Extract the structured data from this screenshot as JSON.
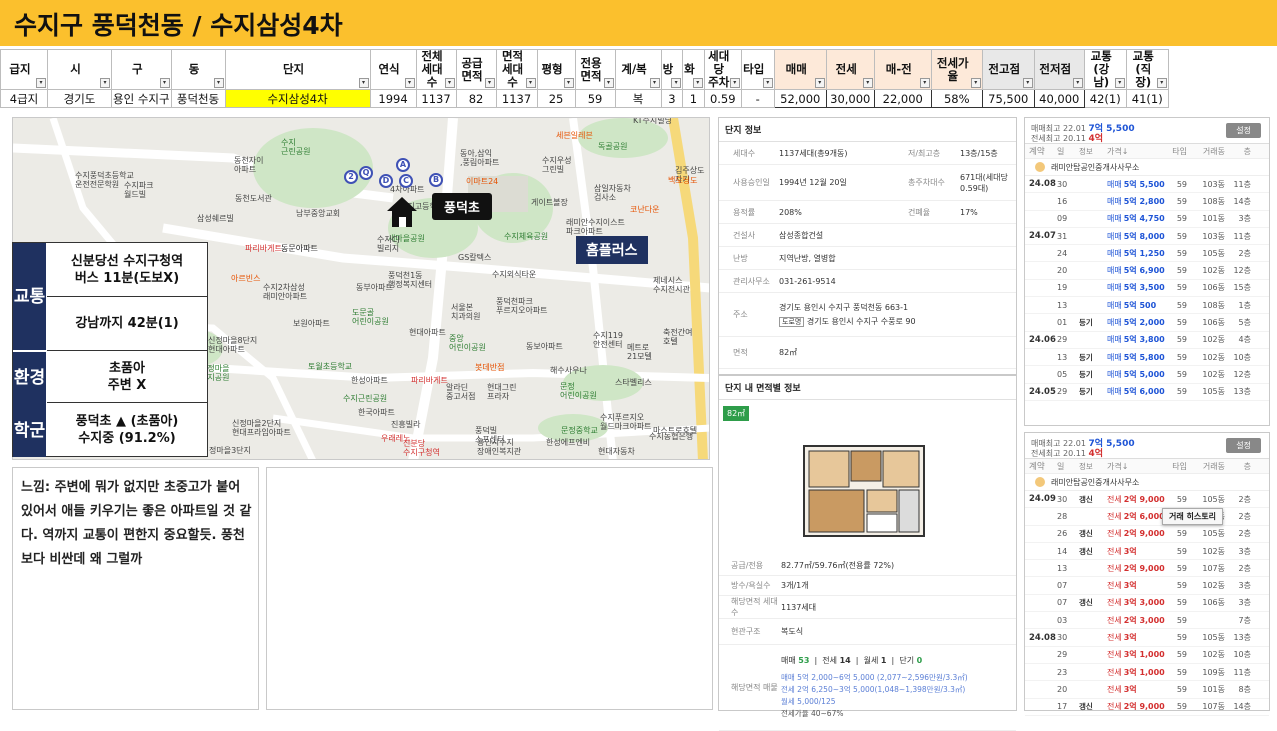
{
  "title": "수지구 풍덕천동 / 수지삼성4차",
  "table": {
    "headers": [
      "급지",
      "시",
      "구",
      "동",
      "단지",
      "연식",
      "전체\n세대수",
      "공급\n면적",
      "면적\n세대수",
      "평형",
      "전용\n면적",
      "계/복",
      "방",
      "화",
      "세대당\n주차",
      "타입",
      "매매",
      "전세",
      "매-전",
      "전세가율",
      "전고점",
      "전저점",
      "교통\n(강남)",
      "교통\n(직장)"
    ],
    "row": [
      "4급지",
      "경기도",
      "용인 수지구",
      "풍덕천동",
      "수지삼성4차",
      "1994",
      "1137",
      "82",
      "1137",
      "25",
      "59",
      "복",
      "3",
      "1",
      "0.59",
      "-",
      "52,000",
      "30,000",
      "22,000",
      "58%",
      "75,500",
      "40,000",
      "42(1)",
      "41(1)"
    ]
  },
  "map": {
    "labels": [
      {
        "t": "KT수지빌딩",
        "c": ""
      },
      {
        "t": "세븐일레븐",
        "c": "o"
      },
      {
        "t": "수지\n근린공원",
        "c": "g"
      },
      {
        "t": "동천자이\n아파트",
        "c": ""
      },
      {
        "t": "수지풍덕초등학교\n운전전문학원",
        "c": ""
      },
      {
        "t": "수지파크\n월드빌",
        "c": ""
      },
      {
        "t": "동천도서관",
        "c": ""
      },
      {
        "t": "남부중앙교회",
        "c": ""
      },
      {
        "t": "삼성쉐르빌",
        "c": ""
      },
      {
        "t": "동아,삼익\n,풍림아파트",
        "c": ""
      },
      {
        "t": "이마트24",
        "c": "o"
      },
      {
        "t": "수지우성\n그린빌",
        "c": ""
      },
      {
        "t": "독골공원",
        "c": "g"
      },
      {
        "t": "김주상도자기",
        "c": ""
      },
      {
        "t": "삼일자동차\n검사소",
        "c": ""
      },
      {
        "t": "게이트볼장",
        "c": ""
      },
      {
        "t": "래미안수지이스트\n파크아파트",
        "c": ""
      },
      {
        "t": "백도닝도",
        "c": "o"
      },
      {
        "t": "동문아파트",
        "c": ""
      },
      {
        "t": "파리바게트",
        "c": "r"
      },
      {
        "t": "새마을공원",
        "c": "g"
      },
      {
        "t": "수지체육공원",
        "c": "g"
      },
      {
        "t": "GS칼텍스",
        "c": ""
      },
      {
        "t": "풍덕천1동\n행정복지센터",
        "c": ""
      },
      {
        "t": "수지외식타운",
        "c": ""
      },
      {
        "t": "제네시스\n수지전시관",
        "c": ""
      },
      {
        "t": "아르빈스",
        "c": "o"
      },
      {
        "t": "수지2차삼성\n래미안아파트",
        "c": ""
      },
      {
        "t": "동부아파트",
        "c": ""
      },
      {
        "t": "도문골\n어린이공원",
        "c": "g"
      },
      {
        "t": "보원아파트",
        "c": ""
      },
      {
        "t": "서울본\n치과의원",
        "c": ""
      },
      {
        "t": "풍덕천파크\n푸르지오아파트",
        "c": ""
      },
      {
        "t": "현대아파트",
        "c": ""
      },
      {
        "t": "중앙\n어린이공원",
        "c": "g"
      },
      {
        "t": "동보아파트",
        "c": ""
      },
      {
        "t": "수지119\n안전센터",
        "c": ""
      },
      {
        "t": "메트로\n21모텔",
        "c": ""
      },
      {
        "t": "신정마을8단지\n현대아파트",
        "c": ""
      },
      {
        "t": "토월초등학교",
        "c": "g"
      },
      {
        "t": "한성아파트",
        "c": ""
      },
      {
        "t": "파리바게트",
        "c": "r"
      },
      {
        "t": "봇데반점",
        "c": "o"
      },
      {
        "t": "신정마을\n수지공원",
        "c": "g"
      },
      {
        "t": "알라딘\n중고서점",
        "c": ""
      },
      {
        "t": "현대그린\n프라자",
        "c": ""
      },
      {
        "t": "해수사우나",
        "c": ""
      },
      {
        "t": "문정\n어린이공원",
        "c": "g"
      },
      {
        "t": "스타벨리스",
        "c": ""
      },
      {
        "t": "수지근린공원",
        "c": "g"
      },
      {
        "t": "한국아파트",
        "c": ""
      },
      {
        "t": "진흥빌라",
        "c": ""
      },
      {
        "t": "신정마을2단지\n현대프라임아파트",
        "c": ""
      },
      {
        "t": "우래레노",
        "c": "r"
      },
      {
        "t": "정마을3단지",
        "c": ""
      },
      {
        "t": "풍덕빌\n스프센터",
        "c": ""
      },
      {
        "t": "용인시수지\n장애인복지관",
        "c": ""
      },
      {
        "t": "문정중학교",
        "c": "g"
      },
      {
        "t": "수지푸르지오\n월드마크아파트",
        "c": ""
      },
      {
        "t": "한성에프엔비",
        "c": ""
      },
      {
        "t": "마스트로호텔",
        "c": ""
      },
      {
        "t": "현대자동차",
        "c": ""
      },
      {
        "t": "수지농협은행",
        "c": ""
      },
      {
        "t": "축전간여\n호텔",
        "c": ""
      },
      {
        "t": "코난다운",
        "c": "o"
      },
      {
        "t": "4차아파트",
        "c": ""
      },
      {
        "t": "수지고등학교",
        "c": ""
      },
      {
        "t": "수지CJ\n빌리지",
        "c": ""
      },
      {
        "t": "동문아파트",
        "c": ""
      },
      {
        "t": "신분당\n수지구청역",
        "c": "r"
      }
    ],
    "school_label": "풍덕초",
    "mall_label": "홈플러스",
    "pins": [
      "Q",
      "A",
      "B",
      "C",
      "D",
      "2"
    ]
  },
  "info_box": {
    "traffic_cat": "교통",
    "traffic": [
      "신분당선 수지구청역\n버스 11분(도보X)",
      "강남까지 42분(1)"
    ],
    "env_cat": "환경",
    "school_cat": "학군",
    "env": [
      "초품아\n주변 X"
    ],
    "school": [
      "풍덕초 ▲ (초품아)\n수지중 (91.2%)"
    ]
  },
  "memo": "느낌: 주변에 뭐가 없지만 초중고가 붙어 있어서 애들 키우기는 좋은 아파트일 것 같다. 역까지 교통이 편한지 중요할듯. 풍천보다 비싼데 왜 그럴까",
  "complex": {
    "title": "단지 정보",
    "rows": [
      {
        "k": "세대수",
        "v": "1137세대(총9개동)",
        "k2": "저/최고층",
        "v2": "13층/15층"
      },
      {
        "k": "사용승인일",
        "v": "1994년 12월 20일",
        "k2": "총주차대수",
        "v2": "671대(세대당 0.59대)"
      },
      {
        "k": "용적률",
        "v": "208%",
        "k2": "건폐율",
        "v2": "17%"
      },
      {
        "k": "건설사",
        "v": "삼성종합건설"
      },
      {
        "k": "난방",
        "v": "지역난방, 열병합"
      },
      {
        "k": "관리사무소",
        "v": "031-261-9514"
      },
      {
        "k": "주소",
        "v": "경기도 용인시 수지구 풍덕천동 663-1",
        "v_road_tag": "도로명",
        "v_road": "경기도 용인시 수지구 수풍로 90"
      },
      {
        "k": "면적",
        "v": "82㎡"
      }
    ]
  },
  "plan": {
    "title": "단지 내 면적별 정보",
    "tab": "82㎡",
    "rows": [
      {
        "k": "공급/전용",
        "v": "82.77㎡/59.76㎡(전용률 72%)"
      },
      {
        "k": "방수/욕실수",
        "v": "3개/1개"
      },
      {
        "k": "해당면적 세대수",
        "v": "1137세대"
      },
      {
        "k": "현관구조",
        "v": "복도식"
      }
    ],
    "counts": {
      "매매": "53",
      "전세": "14",
      "월세": "1",
      "단기": "0"
    },
    "price_k": "해당면적 매물",
    "price_lines": [
      "매매 5억 2,000~6억 5,000 (2,077~2,596만원/3.3㎡)",
      "전세 2억 6,250~3억 5,000(1,048~1,398만원/3.3㎡)",
      "월세 5,000/125",
      "전세가율 40~67%"
    ]
  },
  "trade1": {
    "hi_label": "매매최고",
    "hi_date": "22.01",
    "hi_val": "7억 5,500",
    "lo_label": "전세최고",
    "lo_date": "20.11",
    "lo_val": "4억",
    "btn": "설정",
    "cols": [
      "계약",
      "일",
      "정보",
      "가격↓",
      "타입",
      "거래동",
      "층"
    ],
    "agent": "래미안탑공인중개사사무소",
    "rows": [
      {
        "m": "24.08",
        "d": "30",
        "i": "",
        "p": "5억 5,500",
        "t": "59",
        "b": "103동",
        "f": "11층"
      },
      {
        "m": "",
        "d": "16",
        "i": "",
        "p": "5억 2,800",
        "t": "59",
        "b": "108동",
        "f": "14층"
      },
      {
        "m": "",
        "d": "09",
        "i": "",
        "p": "5억 4,750",
        "t": "59",
        "b": "101동",
        "f": "3층"
      },
      {
        "m": "24.07",
        "d": "31",
        "i": "",
        "p": "5억 8,000",
        "t": "59",
        "b": "103동",
        "f": "11층"
      },
      {
        "m": "",
        "d": "24",
        "i": "",
        "p": "5억 1,250",
        "t": "59",
        "b": "105동",
        "f": "2층"
      },
      {
        "m": "",
        "d": "20",
        "i": "",
        "p": "5억 6,900",
        "t": "59",
        "b": "102동",
        "f": "12층"
      },
      {
        "m": "",
        "d": "19",
        "i": "",
        "p": "5억 3,500",
        "t": "59",
        "b": "106동",
        "f": "15층"
      },
      {
        "m": "",
        "d": "13",
        "i": "",
        "p": "5억 500",
        "t": "59",
        "b": "108동",
        "f": "1층"
      },
      {
        "m": "",
        "d": "01",
        "i": "등기",
        "p": "5억 2,000",
        "t": "59",
        "b": "106동",
        "f": "5층"
      },
      {
        "m": "24.06",
        "d": "29",
        "i": "",
        "p": "5억 3,800",
        "t": "59",
        "b": "102동",
        "f": "4층"
      },
      {
        "m": "",
        "d": "13",
        "i": "등기",
        "p": "5억 5,800",
        "t": "59",
        "b": "102동",
        "f": "10층"
      },
      {
        "m": "",
        "d": "05",
        "i": "등기",
        "p": "5억 5,000",
        "t": "59",
        "b": "102동",
        "f": "12층"
      },
      {
        "m": "24.05",
        "d": "29",
        "i": "등기",
        "p": "5억 6,000",
        "t": "59",
        "b": "105동",
        "f": "13층"
      }
    ]
  },
  "trade2": {
    "hi_label": "매매최고",
    "hi_date": "22.01",
    "hi_val": "7억 5,500",
    "lo_label": "전세최고",
    "lo_date": "20.11",
    "lo_val": "4억",
    "btn": "설정",
    "cols": [
      "계약",
      "일",
      "정보",
      "가격↓",
      "타입",
      "거래동",
      "층"
    ],
    "agent": "래미안탑공인중개사사무소",
    "tooltip": "거래 히스토리",
    "rows": [
      {
        "m": "24.09",
        "d": "30",
        "i": "갱신",
        "p": "2억 9,000",
        "t": "59",
        "b": "105동",
        "f": "2층"
      },
      {
        "m": "",
        "d": "28",
        "i": "",
        "p": "2억 6,000",
        "t": "59",
        "b": "106동",
        "f": "2층"
      },
      {
        "m": "",
        "d": "26",
        "i": "갱신",
        "p": "2억 9,000",
        "t": "59",
        "b": "105동",
        "f": "2층"
      },
      {
        "m": "",
        "d": "14",
        "i": "갱신",
        "p": "3억",
        "t": "59",
        "b": "102동",
        "f": "3층"
      },
      {
        "m": "",
        "d": "13",
        "i": "",
        "p": "2억 9,000",
        "t": "59",
        "b": "107동",
        "f": "2층"
      },
      {
        "m": "",
        "d": "07",
        "i": "",
        "p": "3억",
        "t": "59",
        "b": "102동",
        "f": "3층"
      },
      {
        "m": "",
        "d": "07",
        "i": "갱신",
        "p": "3억 3,000",
        "t": "59",
        "b": "106동",
        "f": "3층"
      },
      {
        "m": "",
        "d": "03",
        "i": "",
        "p": "2억 3,000",
        "t": "59",
        "b": "",
        "f": "7층"
      },
      {
        "m": "24.08",
        "d": "30",
        "i": "",
        "p": "3억",
        "t": "59",
        "b": "105동",
        "f": "13층"
      },
      {
        "m": "",
        "d": "29",
        "i": "",
        "p": "3억 1,000",
        "t": "59",
        "b": "102동",
        "f": "10층"
      },
      {
        "m": "",
        "d": "23",
        "i": "",
        "p": "3억 1,000",
        "t": "59",
        "b": "109동",
        "f": "11층"
      },
      {
        "m": "",
        "d": "20",
        "i": "",
        "p": "3억",
        "t": "59",
        "b": "101동",
        "f": "8층"
      },
      {
        "m": "",
        "d": "17",
        "i": "갱신",
        "p": "2억 9,000",
        "t": "59",
        "b": "107동",
        "f": "14층"
      }
    ]
  },
  "labels": {
    "buy": "매매",
    "rent": "전세",
    "maeme": "매매",
    "jeonse": "전세",
    "wolse": "월세",
    "dangi": "단기"
  },
  "colors": {
    "title_bg": "#fbc02d",
    "navy": "#1f3160",
    "highlight": "#ffff00",
    "buy": "#1e54d6",
    "rent": "#d32f2f"
  }
}
